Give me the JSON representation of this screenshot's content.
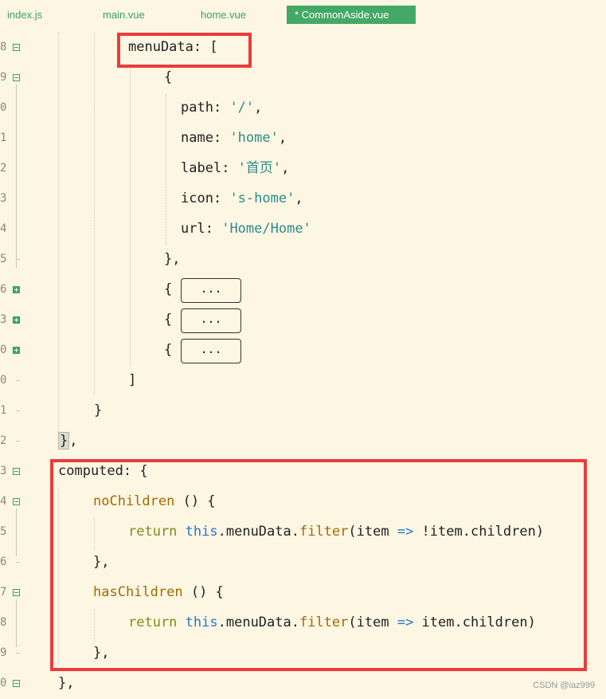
{
  "tabs": [
    {
      "label": "index.js",
      "active": false
    },
    {
      "label": "main.vue",
      "active": false
    },
    {
      "label": "home.vue",
      "active": false
    },
    {
      "label": "* CommonAside.vue",
      "active": true
    }
  ],
  "line_numbers": [
    "8",
    "9",
    "0",
    "1",
    "2",
    "3",
    "4",
    "5",
    "6",
    "3",
    "0",
    "0",
    "1",
    "2",
    "3",
    "4",
    "5",
    "6",
    "7",
    "8",
    "9",
    "0"
  ],
  "code": {
    "menuData_key": "menuData",
    "menuData_open": ": [",
    "obj_open": "{",
    "path_key": "path",
    "path_val": "'/'",
    "name_key": "name",
    "name_val": "'home'",
    "label_key": "label",
    "label_val": "'首页'",
    "icon_key": "icon",
    "icon_val": "'s-home'",
    "url_key": "url",
    "url_val": "'Home/Home'",
    "colon": ": ",
    "comma": ",",
    "obj_close": "},",
    "collapsed_open": "{",
    "collapsed_placeholder": "...",
    "array_close": "]",
    "block_close": "}",
    "data_close_brace": "}",
    "data_close_comma": ",",
    "computed_key": "computed",
    "computed_open": ": {",
    "noChildren_name": "noChildren",
    "method_sig": " () {",
    "return_kw": "return",
    "this_kw": "this",
    "menuData_ref": ".menuData.",
    "filter_fn": "filter",
    "paren_item": "(item ",
    "arrow": "=>",
    "not_children": " !item.children)",
    "yes_children": " item.children)",
    "method_close": "},",
    "hasChildren_name": "hasChildren",
    "computed_close": "},"
  },
  "watermark": "CSDN @iaz999",
  "colors": {
    "background": "#fdf6e3",
    "highlight_box": "#ec3b3b",
    "active_tab": "#44a866",
    "string": "#2a8c8c",
    "keyword": "#7f8c1a",
    "function": "#a36b00",
    "this": "#2677c9"
  }
}
